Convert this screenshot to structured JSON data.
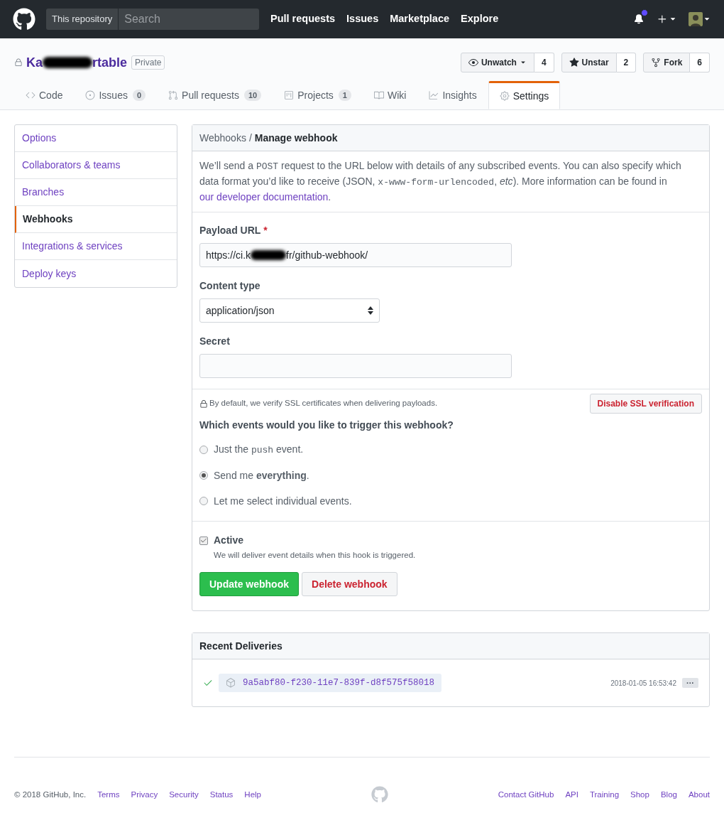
{
  "header": {
    "scope_label": "This repository",
    "search_placeholder": "Search",
    "nav": [
      "Pull requests",
      "Issues",
      "Marketplace",
      "Explore"
    ],
    "notification_unread": true
  },
  "repo": {
    "name_start": "Ka",
    "name_end": "rtable",
    "private_label": "Private",
    "actions": [
      {
        "kind": "watch",
        "label": "Unwatch",
        "count": "4"
      },
      {
        "kind": "star",
        "label": "Unstar",
        "count": "2"
      },
      {
        "kind": "fork",
        "label": "Fork",
        "count": "6"
      }
    ],
    "tabs": [
      {
        "kind": "code",
        "label": "Code",
        "selected": false
      },
      {
        "kind": "issues",
        "label": "Issues",
        "count": "0",
        "selected": false
      },
      {
        "kind": "pulls",
        "label": "Pull requests",
        "count": "10",
        "selected": false
      },
      {
        "kind": "projects",
        "label": "Projects",
        "count": "1",
        "selected": false
      },
      {
        "kind": "wiki",
        "label": "Wiki",
        "selected": false
      },
      {
        "kind": "insights",
        "label": "Insights",
        "selected": false
      },
      {
        "kind": "settings",
        "label": "Settings",
        "selected": true
      }
    ]
  },
  "sidebar": {
    "items": [
      {
        "label": "Options",
        "selected": false
      },
      {
        "label": "Collaborators & teams",
        "selected": false
      },
      {
        "label": "Branches",
        "selected": false
      },
      {
        "label": "Webhooks",
        "selected": true
      },
      {
        "label": "Integrations & services",
        "selected": false
      },
      {
        "label": "Deploy keys",
        "selected": false
      }
    ]
  },
  "webhook": {
    "breadcrumb_parent": "Webhooks",
    "breadcrumb_separator": "/",
    "title": "Manage webhook",
    "intro": [
      {
        "kind": "text",
        "text": "We’ll send a "
      },
      {
        "kind": "code",
        "text": "POST"
      },
      {
        "kind": "text",
        "text": " request to the URL below with details of any subscribed events. You can also specify which data format you’d like to receive (JSON, "
      },
      {
        "kind": "code",
        "text": "x-www-form-urlencoded"
      },
      {
        "kind": "text",
        "text": ", *etc*). More information can be found in "
      },
      {
        "kind": "link",
        "text": "our developer documentation"
      },
      {
        "kind": "text",
        "text": "."
      }
    ],
    "payload_label": "Payload URL",
    "required_mark": "*",
    "payload_url_start": "https://ci.k",
    "payload_url_end": "fr/github-webhook/",
    "content_type_label": "Content type",
    "content_type_value": "application/json",
    "secret_label": "Secret",
    "ssl_note": "By default, we verify SSL certificates when delivering payloads.",
    "ssl_button": "Disable SSL verification",
    "events_question": "Which events would you like to trigger this webhook?",
    "events": [
      {
        "selected": false,
        "label": [
          {
            "kind": "text",
            "text": "Just the "
          },
          {
            "kind": "code",
            "text": "push"
          },
          {
            "kind": "text",
            "text": " event."
          }
        ]
      },
      {
        "selected": true,
        "label": [
          {
            "kind": "text",
            "text": "Send me **everything**."
          }
        ]
      },
      {
        "selected": false,
        "label": [
          {
            "kind": "text",
            "text": "Let me select individual events."
          }
        ]
      }
    ],
    "active": {
      "label": "Active",
      "checked": true,
      "note": "We will deliver event details when this hook is triggered."
    },
    "update_button": "Update webhook",
    "delete_button": "Delete webhook"
  },
  "deliveries": {
    "title": "Recent Deliveries",
    "items": [
      {
        "succeeded": true,
        "id": "9a5abf80-f230-11e7-839f-d8f575f58018",
        "time": "2018-01-05 16:53:42",
        "more": "···"
      }
    ]
  },
  "footer": {
    "copyright": "© 2018 GitHub, Inc.",
    "left_links": [
      "Terms",
      "Privacy",
      "Security",
      "Status",
      "Help"
    ],
    "right_links": [
      "Contact GitHub",
      "API",
      "Training",
      "Shop",
      "Blog",
      "About"
    ]
  }
}
